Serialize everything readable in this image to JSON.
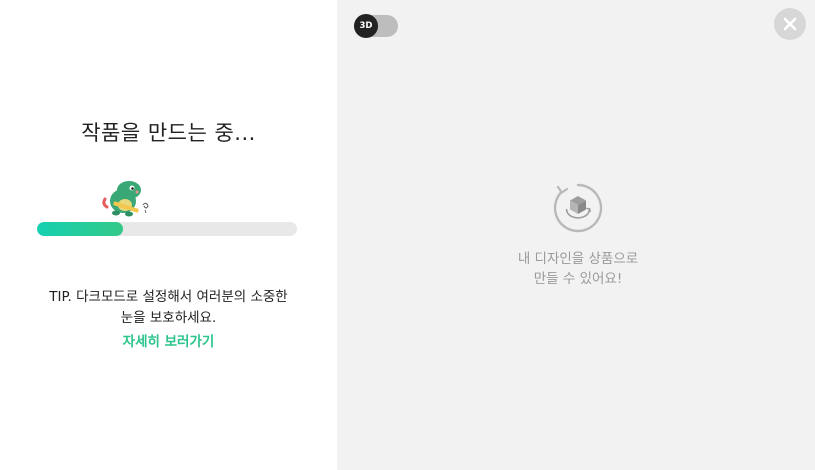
{
  "loading": {
    "title": "작품을 만드는 중...",
    "progress_fraction": 0.33
  },
  "tip": {
    "text_line1": "TIP. 다크모드로 설정해서 여러분의 소중한",
    "text_line2": "눈을 보호하세요.",
    "link_label": "자세히 보러가기"
  },
  "preview": {
    "toggle_label": "3D",
    "message_line1": "내 디자인을 상품으로",
    "message_line2": "만들 수 있어요!"
  },
  "icons": {
    "close": "close-icon",
    "product_rotate": "rotate-cube-icon",
    "mascot": "dinosaur-mascot"
  },
  "colors": {
    "progress_start": "#16d0b0",
    "progress_end": "#34c989",
    "link": "#2bc48a",
    "preview_bg": "#f2f2f2"
  }
}
